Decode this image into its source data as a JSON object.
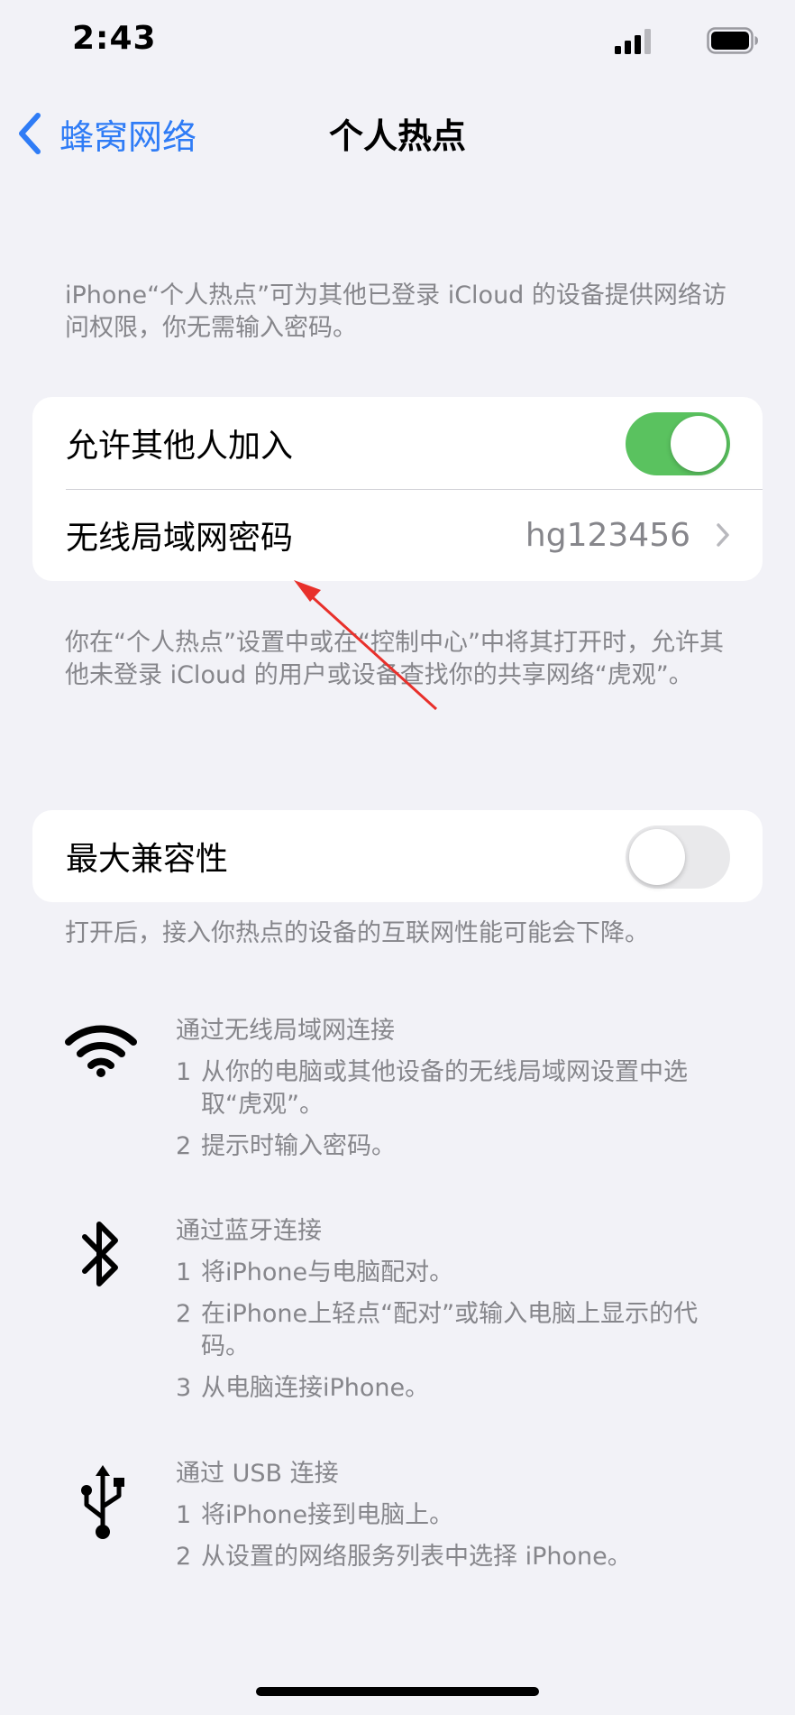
{
  "status_bar": {
    "time": "2:43"
  },
  "nav": {
    "back_label": "蜂窝网络",
    "title": "个人热点"
  },
  "notes": {
    "top": "iPhone“个人热点”可为其他已登录 iCloud 的设备提供网络访问权限，你无需输入密码。",
    "middle": "你在“个人热点”设置中或在“控制中心”中将其打开时，允许其他未登录 iCloud 的用户或设备查找你的共享网络“虎观”。",
    "compat": "打开后，接入你热点的设备的互联网性能可能会下降。"
  },
  "settings": {
    "allow_others_label": "允许其他人加入",
    "allow_others_on": true,
    "wifi_password_label": "无线局域网密码",
    "wifi_password_value": "hg123456",
    "max_compat_label": "最大兼容性",
    "max_compat_on": false
  },
  "methods": {
    "wifi": {
      "title": "通过无线局域网连接",
      "steps": [
        {
          "num": "1",
          "text": "从你的电脑或其他设备的无线局域网设置中选取“虎观”。"
        },
        {
          "num": "2",
          "text": "提示时输入密码。"
        }
      ]
    },
    "bluetooth": {
      "title": "通过蓝牙连接",
      "steps": [
        {
          "num": "1",
          "text": "将iPhone与电脑配对。"
        },
        {
          "num": "2",
          "text": "在iPhone上轻点“配对”或输入电脑上显示的代码。"
        },
        {
          "num": "3",
          "text": "从电脑连接iPhone。"
        }
      ]
    },
    "usb": {
      "title": "通过 USB 连接",
      "steps": [
        {
          "num": "1",
          "text": "将iPhone接到电脑上。"
        },
        {
          "num": "2",
          "text": "从设置的网络服务列表中选择 iPhone。"
        }
      ]
    }
  },
  "colors": {
    "accent": "#2f7cf6",
    "toggle_on": "#5ac25f",
    "annotation_arrow": "#e8302b"
  },
  "icons": [
    "chevron-left-icon",
    "chevron-right-icon",
    "wifi-icon",
    "bluetooth-icon",
    "usb-icon",
    "signal-icon",
    "battery-icon"
  ]
}
